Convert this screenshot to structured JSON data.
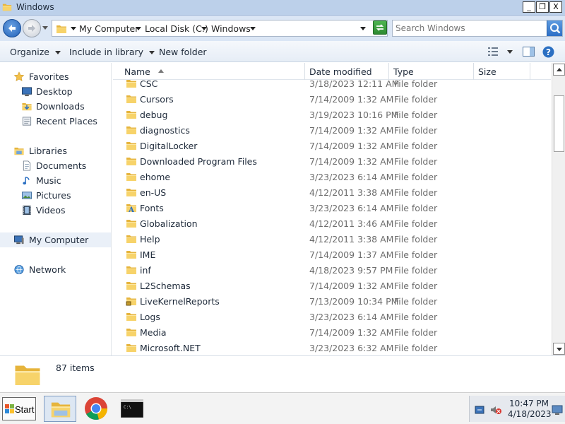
{
  "window": {
    "title": "Windows",
    "buttons": {
      "minimize": "_",
      "restore": "❐",
      "close": "X"
    }
  },
  "address": {
    "segments": [
      "My Computer",
      "Local Disk (C:)",
      "Windows"
    ],
    "search_placeholder": "Search Windows"
  },
  "toolbar": {
    "organize": "Organize",
    "include_in_library": "Include in library",
    "new_folder": "New folder"
  },
  "nav": {
    "favorites": {
      "label": "Favorites",
      "items": [
        "Desktop",
        "Downloads",
        "Recent Places"
      ]
    },
    "libraries": {
      "label": "Libraries",
      "items": [
        "Documents",
        "Music",
        "Pictures",
        "Videos"
      ]
    },
    "computer": "My Computer",
    "network": "Network"
  },
  "columns": {
    "name": "Name",
    "date": "Date modified",
    "type": "Type",
    "size": "Size"
  },
  "files": [
    {
      "name": "CSC",
      "date": "3/18/2023 12:11 AM",
      "type": "File folder",
      "icon": "folder-icon"
    },
    {
      "name": "Cursors",
      "date": "7/14/2009 1:32 AM",
      "type": "File folder",
      "icon": "folder-icon"
    },
    {
      "name": "debug",
      "date": "3/19/2023 10:16 PM",
      "type": "File folder",
      "icon": "folder-icon"
    },
    {
      "name": "diagnostics",
      "date": "7/14/2009 1:32 AM",
      "type": "File folder",
      "icon": "folder-icon"
    },
    {
      "name": "DigitalLocker",
      "date": "7/14/2009 1:32 AM",
      "type": "File folder",
      "icon": "folder-icon"
    },
    {
      "name": "Downloaded Program Files",
      "date": "7/14/2009 1:32 AM",
      "type": "File folder",
      "icon": "folder-icon"
    },
    {
      "name": "ehome",
      "date": "3/23/2023 6:14 AM",
      "type": "File folder",
      "icon": "folder-icon"
    },
    {
      "name": "en-US",
      "date": "4/12/2011 3:38 AM",
      "type": "File folder",
      "icon": "folder-icon"
    },
    {
      "name": "Fonts",
      "date": "3/23/2023 6:14 AM",
      "type": "File folder",
      "icon": "fonts-folder-icon"
    },
    {
      "name": "Globalization",
      "date": "4/12/2011 3:46 AM",
      "type": "File folder",
      "icon": "folder-icon"
    },
    {
      "name": "Help",
      "date": "4/12/2011 3:38 AM",
      "type": "File folder",
      "icon": "folder-icon"
    },
    {
      "name": "IME",
      "date": "7/14/2009 1:37 AM",
      "type": "File folder",
      "icon": "folder-icon"
    },
    {
      "name": "inf",
      "date": "4/18/2023 9:57 PM",
      "type": "File folder",
      "icon": "folder-icon"
    },
    {
      "name": "L2Schemas",
      "date": "7/14/2009 1:32 AM",
      "type": "File folder",
      "icon": "folder-icon"
    },
    {
      "name": "LiveKernelReports",
      "date": "7/13/2009 10:34 PM",
      "type": "File folder",
      "icon": "locked-folder-icon"
    },
    {
      "name": "Logs",
      "date": "3/23/2023 6:14 AM",
      "type": "File folder",
      "icon": "folder-icon"
    },
    {
      "name": "Media",
      "date": "7/14/2009 1:32 AM",
      "type": "File folder",
      "icon": "folder-icon"
    },
    {
      "name": "Microsoft.NET",
      "date": "3/23/2023 6:32 AM",
      "type": "File folder",
      "icon": "folder-icon"
    }
  ],
  "details": {
    "count": "87 items"
  },
  "taskbar": {
    "start": "Start",
    "apps": [
      "explorer-icon",
      "chrome-icon",
      "cmd-icon"
    ],
    "time": "10:47 PM",
    "date": "4/18/2023"
  },
  "colors": {
    "title_bar": "#bcd0ea",
    "nav_selected": "#eaf0f8",
    "folder": "#f3c84f"
  }
}
